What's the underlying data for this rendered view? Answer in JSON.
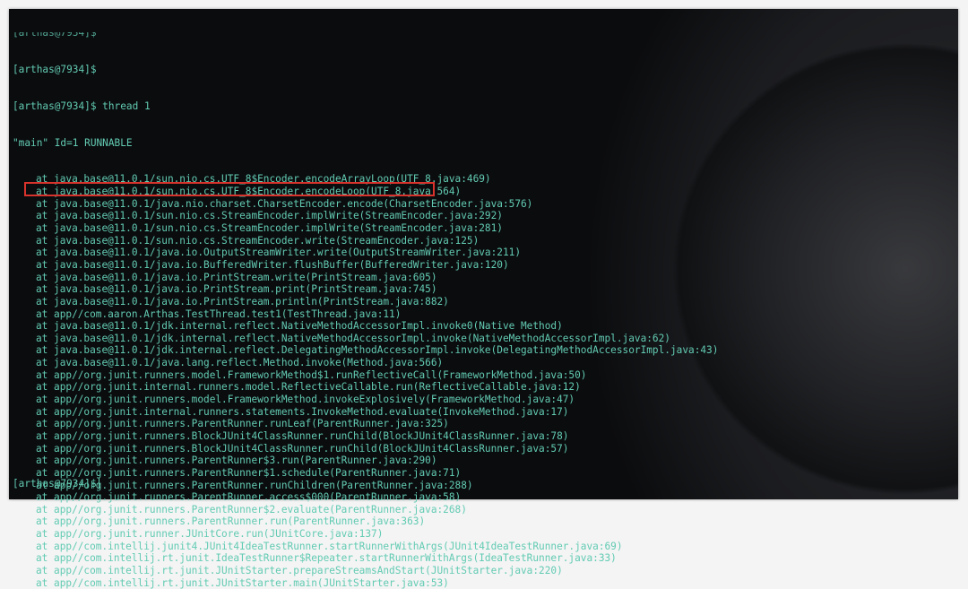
{
  "terminal": {
    "prompt": "[arthas@7934]$",
    "history": [
      "[arthas@7934]$",
      "[arthas@7934]$ thread 1"
    ],
    "thread_header": "\"main\" Id=1 RUNNABLE",
    "frames": [
      "at java.base@11.0.1/sun.nio.cs.UTF_8$Encoder.encodeArrayLoop(UTF_8.java:469)",
      "at java.base@11.0.1/sun.nio.cs.UTF_8$Encoder.encodeLoop(UTF_8.java:564)",
      "at java.base@11.0.1/java.nio.charset.CharsetEncoder.encode(CharsetEncoder.java:576)",
      "at java.base@11.0.1/sun.nio.cs.StreamEncoder.implWrite(StreamEncoder.java:292)",
      "at java.base@11.0.1/sun.nio.cs.StreamEncoder.implWrite(StreamEncoder.java:281)",
      "at java.base@11.0.1/sun.nio.cs.StreamEncoder.write(StreamEncoder.java:125)",
      "at java.base@11.0.1/java.io.OutputStreamWriter.write(OutputStreamWriter.java:211)",
      "at java.base@11.0.1/java.io.BufferedWriter.flushBuffer(BufferedWriter.java:120)",
      "at java.base@11.0.1/java.io.PrintStream.write(PrintStream.java:605)",
      "at java.base@11.0.1/java.io.PrintStream.print(PrintStream.java:745)",
      "at java.base@11.0.1/java.io.PrintStream.println(PrintStream.java:882)",
      "at app//com.aaron.Arthas.TestThread.test1(TestThread.java:11)",
      "at java.base@11.0.1/jdk.internal.reflect.NativeMethodAccessorImpl.invoke0(Native Method)",
      "at java.base@11.0.1/jdk.internal.reflect.NativeMethodAccessorImpl.invoke(NativeMethodAccessorImpl.java:62)",
      "at java.base@11.0.1/jdk.internal.reflect.DelegatingMethodAccessorImpl.invoke(DelegatingMethodAccessorImpl.java:43)",
      "at java.base@11.0.1/java.lang.reflect.Method.invoke(Method.java:566)",
      "at app//org.junit.runners.model.FrameworkMethod$1.runReflectiveCall(FrameworkMethod.java:50)",
      "at app//org.junit.internal.runners.model.ReflectiveCallable.run(ReflectiveCallable.java:12)",
      "at app//org.junit.runners.model.FrameworkMethod.invokeExplosively(FrameworkMethod.java:47)",
      "at app//org.junit.internal.runners.statements.InvokeMethod.evaluate(InvokeMethod.java:17)",
      "at app//org.junit.runners.ParentRunner.runLeaf(ParentRunner.java:325)",
      "at app//org.junit.runners.BlockJUnit4ClassRunner.runChild(BlockJUnit4ClassRunner.java:78)",
      "at app//org.junit.runners.BlockJUnit4ClassRunner.runChild(BlockJUnit4ClassRunner.java:57)",
      "at app//org.junit.runners.ParentRunner$3.run(ParentRunner.java:290)",
      "at app//org.junit.runners.ParentRunner$1.schedule(ParentRunner.java:71)",
      "at app//org.junit.runners.ParentRunner.runChildren(ParentRunner.java:288)",
      "at app//org.junit.runners.ParentRunner.access$000(ParentRunner.java:58)",
      "at app//org.junit.runners.ParentRunner$2.evaluate(ParentRunner.java:268)",
      "at app//org.junit.runners.ParentRunner.run(ParentRunner.java:363)",
      "at app//org.junit.runner.JUnitCore.run(JUnitCore.java:137)",
      "at app//com.intellij.junit4.JUnit4IdeaTestRunner.startRunnerWithArgs(JUnit4IdeaTestRunner.java:69)",
      "at app//com.intellij.rt.junit.IdeaTestRunner$Repeater.startRunnerWithArgs(IdeaTestRunner.java:33)",
      "at app//com.intellij.rt.junit.JUnitStarter.prepareStreamsAndStart(JUnitStarter.java:220)",
      "at app//com.intellij.rt.junit.JUnitStarter.main(JUnitStarter.java:53)"
    ],
    "highlighted_frame_index": 11,
    "colors": {
      "text": "#62cbb3",
      "highlight_box": "#d8332c",
      "background": "#0a0b0d"
    }
  }
}
